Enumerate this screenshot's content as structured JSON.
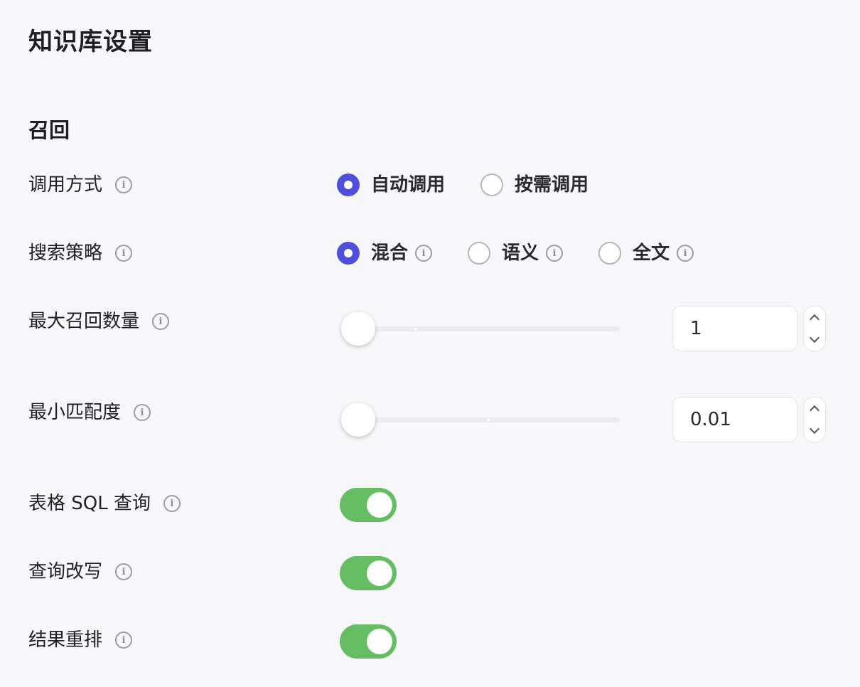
{
  "page": {
    "title": "知识库设置"
  },
  "section": {
    "title": "召回"
  },
  "settings": {
    "invoke_mode": {
      "label": "调用方式",
      "options": [
        {
          "label": "自动调用",
          "checked": true
        },
        {
          "label": "按需调用",
          "checked": false
        }
      ]
    },
    "search_strategy": {
      "label": "搜索策略",
      "options": [
        {
          "label": "混合",
          "checked": true
        },
        {
          "label": "语义",
          "checked": false
        },
        {
          "label": "全文",
          "checked": false
        }
      ]
    },
    "max_recall": {
      "label": "最大召回数量",
      "value": "1"
    },
    "min_match": {
      "label": "最小匹配度",
      "value": "0.01"
    },
    "table_sql": {
      "label": "表格 SQL 查询",
      "enabled": true
    },
    "query_rewrite": {
      "label": "查询改写",
      "enabled": true
    },
    "result_rerank": {
      "label": "结果重排",
      "enabled": true
    }
  },
  "icons": {
    "info": "info-icon",
    "info_glyph": "i"
  },
  "colors": {
    "accent": "#4f4fdb",
    "toggle_on": "#64bd63",
    "background": "#f7f7f9"
  }
}
